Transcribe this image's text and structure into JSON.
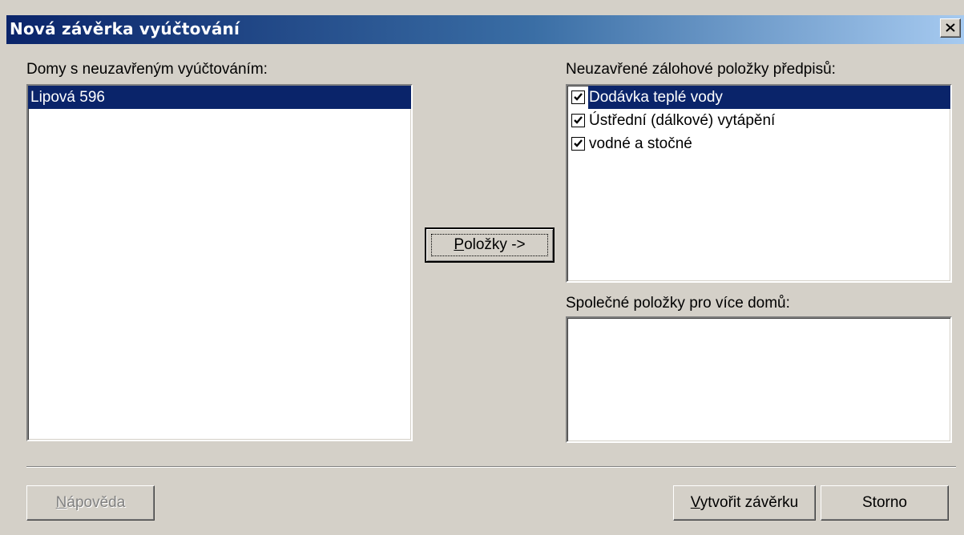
{
  "window": {
    "title": "Nová závěrka vyúčtování",
    "close_label": "×"
  },
  "left_panel": {
    "label": "Domy s neuzavřeným vyúčtováním:",
    "items": [
      {
        "label": "Lipová 596",
        "selected": true
      }
    ]
  },
  "middle": {
    "items_button": {
      "mnemonic": "P",
      "rest": "oložky ->"
    }
  },
  "right_top": {
    "label": "Neuzavřené zálohové položky předpisů:",
    "items": [
      {
        "label": "Dodávka teplé vody",
        "checked": true,
        "selected": true
      },
      {
        "label": "Ústřední (dálkové) vytápění",
        "checked": true,
        "selected": false
      },
      {
        "label": "vodné a stočné",
        "checked": true,
        "selected": false
      }
    ]
  },
  "right_bottom": {
    "label": "Společné položky pro více domů:",
    "items": []
  },
  "footer": {
    "help_button": {
      "mnemonic": "N",
      "rest": "ápověda",
      "enabled": false
    },
    "create_button": {
      "mnemonic": "V",
      "rest": "ytvořit závěrku"
    },
    "cancel_button": {
      "label": "Storno"
    }
  },
  "colors": {
    "dialog_bg": "#d4d0c8",
    "selection": "#0a246a",
    "title_gradient_start": "#0a246a",
    "title_gradient_end": "#a6caf0"
  }
}
